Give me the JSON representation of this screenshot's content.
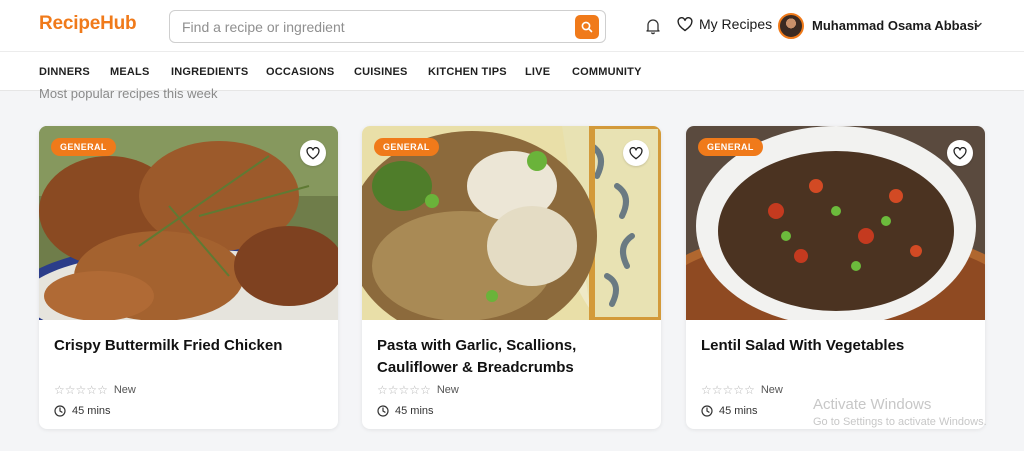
{
  "header": {
    "logo": "RecipeHub",
    "search_placeholder": "Find a recipe or ingredient",
    "my_recipes_label": "My Recipes",
    "user_name": "Muhammad Osama Abbasi",
    "accent_color": "#f07a1a"
  },
  "nav": {
    "items": [
      "DINNERS",
      "MEALS",
      "INGREDIENTS",
      "OCCASIONS",
      "CUISINES",
      "KITCHEN TIPS",
      "LIVE",
      "COMMUNITY"
    ]
  },
  "main": {
    "subtitle": "Most popular recipes this week",
    "cards": [
      {
        "badge": "GENERAL",
        "title": "Crispy Buttermilk Fried Chicken",
        "rating_label": "New",
        "time": "45 mins",
        "image": "fried-chicken-photo"
      },
      {
        "badge": "GENERAL",
        "title": "Pasta with Garlic, Scallions, Cauliflower & Breadcrumbs",
        "rating_label": "New",
        "time": "45 mins",
        "image": "cauliflower-pasta-photo"
      },
      {
        "badge": "GENERAL",
        "title": "Lentil Salad With Vegetables",
        "rating_label": "New",
        "time": "45 mins",
        "image": "lentil-salad-photo"
      }
    ]
  },
  "watermark": {
    "title": "Activate Windows",
    "subtitle": "Go to Settings to activate Windows."
  }
}
